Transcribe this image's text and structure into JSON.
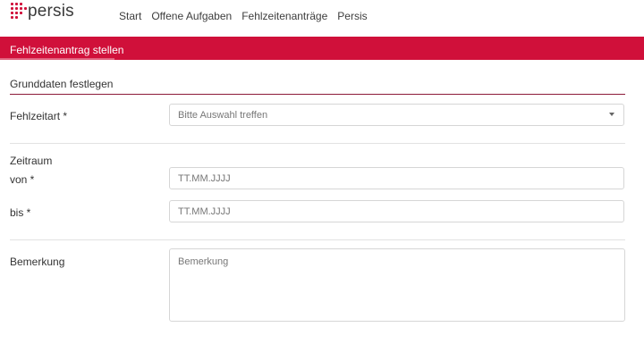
{
  "brand": {
    "logo_text": "persis"
  },
  "nav": {
    "items": [
      "Start",
      "Offene Aufgaben",
      "Fehlzeitenanträge",
      "Persis"
    ]
  },
  "page": {
    "title": "Fehlzeitenantrag stellen"
  },
  "form": {
    "section_title": "Grunddaten festlegen",
    "type_label": "Fehlzeitart *",
    "type_placeholder": "Bitte Auswahl treffen",
    "period_label": "Zeitraum",
    "from_label": "von *",
    "from_placeholder": "TT.MM.JJJJ",
    "to_label": "bis *",
    "to_placeholder": "TT.MM.JJJJ",
    "remark_label": "Bemerkung",
    "remark_placeholder": "Bemerkung"
  },
  "colors": {
    "brand_red": "#d0103a",
    "section_rule": "#8c1b3a"
  }
}
